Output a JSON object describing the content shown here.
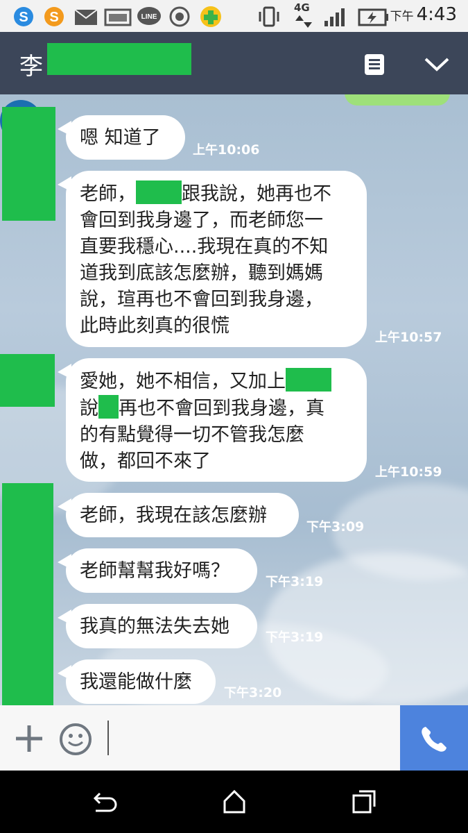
{
  "status_bar": {
    "time_prefix": "下午",
    "time": "4:43",
    "network": "4G",
    "icons": [
      "skype-icon",
      "swipe-icon",
      "mail-icon",
      "image-icon",
      "line-icon",
      "record-icon",
      "game-icon",
      "vibrate-icon",
      "signal-icon",
      "battery-icon"
    ]
  },
  "header": {
    "contact_name": "李",
    "icons": [
      "notes-icon",
      "chevron-down-icon"
    ]
  },
  "messages": [
    {
      "text": "嗯  知道了",
      "time_prefix": "上午",
      "time": "10:06"
    },
    {
      "lines": [
        "老師，",
        "跟我說，她再也不",
        "會回到我身邊了，而老師您一",
        "直要我穩心....我現在真的不知",
        "道我到底該怎麼辦，聽到媽媽",
        "說，瑄再也不會回到我身邊，",
        "此時此刻真的很慌"
      ],
      "time_prefix": "上午",
      "time": "10:57"
    },
    {
      "lines": [
        "愛她，她不相信，又加上",
        "說",
        "再也不會回到我身邊，真",
        "的有點覺得一切不管我怎麼",
        "做，都回不來了"
      ],
      "time_prefix": "上午",
      "time": "10:59"
    },
    {
      "text": "老師，我現在該怎麼辦",
      "time_prefix": "下午",
      "time": "3:09"
    },
    {
      "text": "老師幫幫我好嗎？",
      "time_prefix": "下午",
      "time": "3:19"
    },
    {
      "text": "我真的無法失去她",
      "time_prefix": "下午",
      "time": "3:19"
    },
    {
      "text": "我還能做什麼",
      "time_prefix": "下午",
      "time": "3:20"
    }
  ],
  "input_bar": {
    "icons": [
      "plus-icon",
      "emoji-icon",
      "phone-icon"
    ]
  },
  "nav_bar": {
    "icons": [
      "back-icon",
      "home-icon",
      "recents-icon"
    ]
  },
  "colors": {
    "header_bg": "#3c4659",
    "redaction": "#1fbd4c",
    "call_button": "#4d83dd",
    "sent_bubble": "#9ee07a"
  }
}
